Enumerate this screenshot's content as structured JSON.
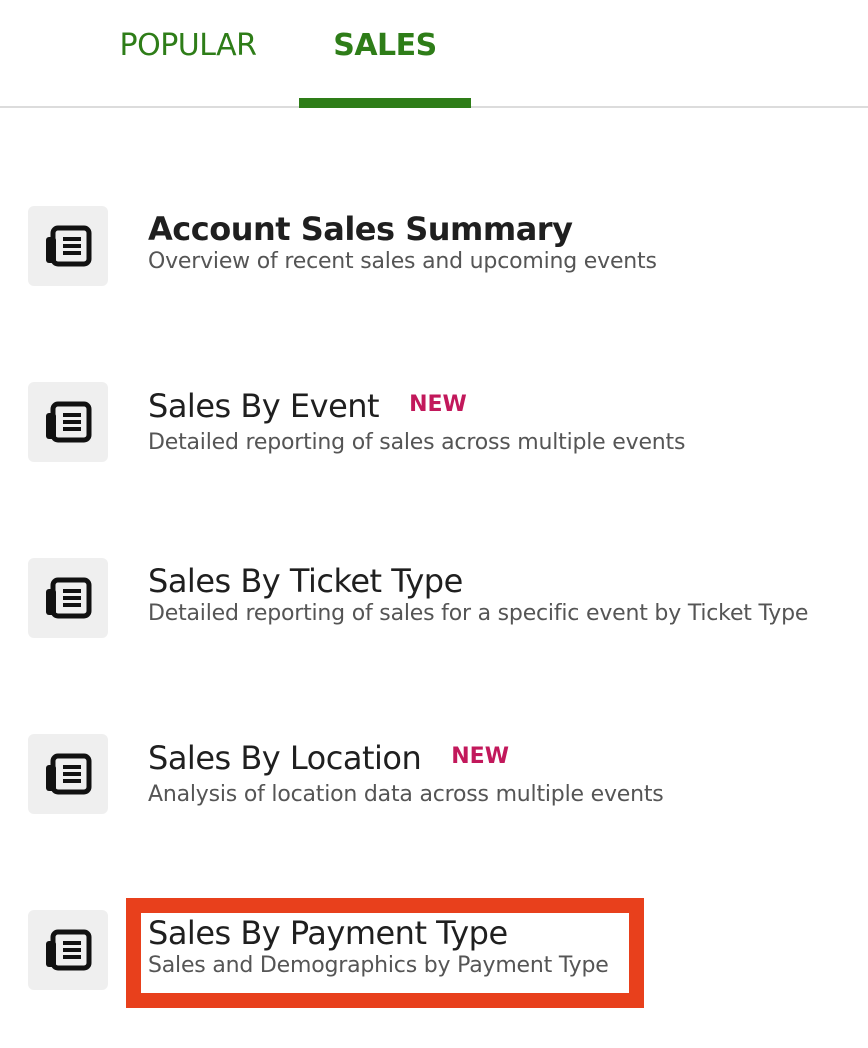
{
  "tabs": [
    {
      "label": "POPULAR",
      "active": false
    },
    {
      "label": "SALES",
      "active": true
    }
  ],
  "accent_color": "#2e7d18",
  "badge_color": "#c2185b",
  "highlight_color": "#e8401c",
  "reports": [
    {
      "title": "Account Sales Summary",
      "description": "Overview of recent sales and upcoming events",
      "icon": "report-document-icon"
    },
    {
      "title": "Sales By Event",
      "badge": "NEW",
      "description": "Detailed reporting of sales across multiple events",
      "icon": "report-document-icon"
    },
    {
      "title": "Sales By Ticket Type",
      "description": "Detailed reporting of sales for a specific event by Ticket Type",
      "icon": "report-document-icon"
    },
    {
      "title": "Sales By Location",
      "badge": "NEW",
      "description": "Analysis of location data across multiple events",
      "icon": "report-document-icon"
    },
    {
      "title": "Sales By Payment Type",
      "description": "Sales and Demographics by Payment Type",
      "icon": "report-document-icon",
      "highlighted": true
    }
  ]
}
